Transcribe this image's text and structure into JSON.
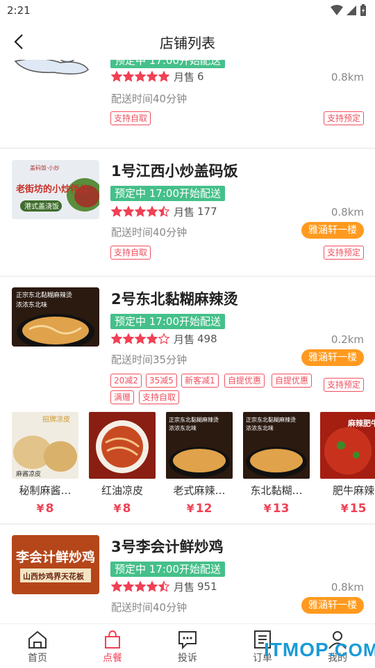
{
  "status": {
    "time": "2:21"
  },
  "header": {
    "title": "店铺列表"
  },
  "common": {
    "preorder": "预定中 17:00开始配送",
    "sales_label": "月售",
    "pickup_tag": "支持自取",
    "preorder_tag": "支持预定",
    "yen": "¥"
  },
  "shops": [
    {
      "name": "",
      "rating": 5,
      "sales": "6",
      "distance": "0.8km",
      "delivery_time": "配送时间40分钟",
      "location": ""
    },
    {
      "name": "1号江西小炒盖码饭",
      "rating": 4.5,
      "sales": "177",
      "distance": "0.8km",
      "delivery_time": "配送时间40分钟",
      "location": "雅涵轩一楼"
    },
    {
      "name": "2号东北黏糊麻辣烫",
      "rating": 4,
      "sales": "498",
      "distance": "0.2km",
      "delivery_time": "配送时间35分钟",
      "location": "雅涵轩一楼",
      "tags": [
        "20减2",
        "35减5",
        "新客减1",
        "自提优惠",
        "自提优惠",
        "满赠",
        "支持自取"
      ],
      "dishes": [
        {
          "name": "秘制麻酱…",
          "price": "8"
        },
        {
          "name": "红油凉皮",
          "price": "8"
        },
        {
          "name": "老式麻辣…",
          "price": "12"
        },
        {
          "name": "东北黏糊…",
          "price": "13"
        },
        {
          "name": "肥牛麻辣",
          "price": "15"
        }
      ]
    },
    {
      "name": "3号李会计鲜炒鸡",
      "rating": 4.5,
      "sales": "951",
      "distance": "0.8km",
      "delivery_time": "配送时间40分钟",
      "location": "雅涵轩一楼"
    }
  ],
  "thumb_text": {
    "shop1_banner": "老街坊的小炒伴儿",
    "shop1_sub": "港式盖浇饭",
    "shop1_top": "盖码饭·小炒",
    "shop2_line1": "正宗东北黏糊麻辣烫",
    "shop2_line2": "浓浓东北味",
    "shop3_line1": "李会计鲜炒鸡",
    "shop3_line2": "山西炒鸡界天花板",
    "dish1_label": "招牌凉皮",
    "dish1_sub": "麻酱凉皮",
    "dish5_label": "麻辣肥牛"
  },
  "tabs": [
    {
      "label": "首页",
      "icon": "home-icon",
      "active": false
    },
    {
      "label": "点餐",
      "icon": "shopping-bag-icon",
      "active": true
    },
    {
      "label": "投诉",
      "icon": "chat-icon",
      "active": false
    },
    {
      "label": "订单",
      "icon": "order-list-icon",
      "active": false
    },
    {
      "label": "我的",
      "icon": "user-icon",
      "active": false
    }
  ],
  "watermark": {
    "main": "ITMOP",
    "suffix": ".COM"
  },
  "colors": {
    "accent": "#f04155",
    "preorder_green": "#45c08a",
    "location_orange": "#ff9a1f",
    "watermark_blue": "#1a9bd7"
  }
}
